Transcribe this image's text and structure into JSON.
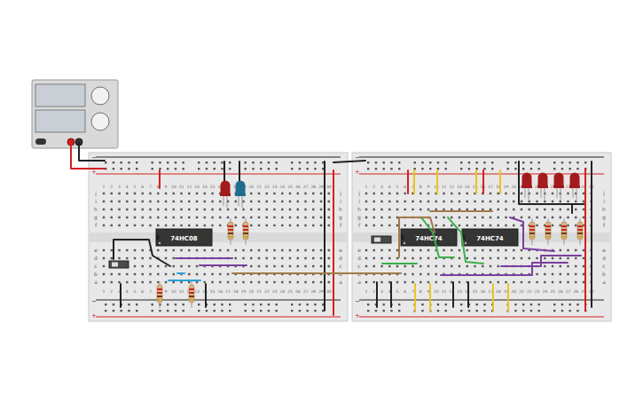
{
  "chips": [
    {
      "label": "74HC08"
    },
    {
      "label": "74HC74"
    },
    {
      "label": "74HC74"
    }
  ],
  "breadboards": [
    {
      "columns": [
        "1",
        "2",
        "3",
        "4",
        "5",
        "6",
        "7",
        "8",
        "9",
        "10",
        "11",
        "12",
        "13",
        "14",
        "15",
        "16",
        "17",
        "18",
        "19",
        "20",
        "21",
        "22",
        "23",
        "24",
        "25",
        "26",
        "27",
        "28",
        "29",
        "30"
      ],
      "rows_top": [
        "j",
        "i",
        "h",
        "g",
        "f"
      ],
      "rows_bottom": [
        "e",
        "d",
        "c",
        "b",
        "a"
      ]
    },
    {
      "columns": [
        "1",
        "2",
        "3",
        "4",
        "5",
        "6",
        "7",
        "8",
        "9",
        "10",
        "11",
        "12",
        "13",
        "14",
        "15",
        "16",
        "17",
        "18",
        "19",
        "20",
        "21",
        "22",
        "23",
        "24",
        "25",
        "26",
        "27",
        "28",
        "29",
        "30"
      ],
      "rows_top": [
        "j",
        "i",
        "h",
        "g",
        "f"
      ],
      "rows_bottom": [
        "e",
        "d",
        "c",
        "b",
        "a"
      ]
    }
  ],
  "rail_signs": {
    "minus": "−",
    "plus": "+"
  },
  "switches": [
    {
      "on": false
    },
    {
      "on": false
    }
  ],
  "leds": [
    {
      "color": "#a3191c"
    },
    {
      "color": "#1f6f8b"
    },
    {
      "color": "#a3191c"
    },
    {
      "color": "#a3191c"
    },
    {
      "color": "#a3191c"
    },
    {
      "color": "#a3191c"
    }
  ],
  "wires": [
    {
      "color": "#d42020"
    },
    {
      "color": "#222222"
    },
    {
      "color": "#d42020"
    },
    {
      "color": "#222222"
    },
    {
      "color": "#222222"
    },
    {
      "color": "#222222"
    },
    {
      "color": "#d42020"
    },
    {
      "color": "#222222"
    },
    {
      "color": "#222222"
    },
    {
      "color": "#7b3fa0"
    },
    {
      "color": "#7b3fa0"
    },
    {
      "color": "#2a9fd6"
    },
    {
      "color": "#2a9fd6"
    },
    {
      "color": "#a07a4a"
    },
    {
      "color": "#222222"
    },
    {
      "color": "#222222"
    },
    {
      "color": "#d42020"
    },
    {
      "color": "#e8c520"
    },
    {
      "color": "#e8c520"
    },
    {
      "color": "#e8c520"
    },
    {
      "color": "#d42020"
    },
    {
      "color": "#e8c520"
    },
    {
      "color": "#222222"
    },
    {
      "color": "#3cb04a"
    },
    {
      "color": "#3cb04a"
    },
    {
      "color": "#3cb04a"
    },
    {
      "color": "#a07a4a"
    },
    {
      "color": "#a07a4a"
    },
    {
      "color": "#e8c520"
    },
    {
      "color": "#e8c520"
    },
    {
      "color": "#e8c520"
    },
    {
      "color": "#e8c520"
    },
    {
      "color": "#222222"
    },
    {
      "color": "#222222"
    },
    {
      "color": "#222222"
    },
    {
      "color": "#222222"
    },
    {
      "color": "#7b3fa0"
    },
    {
      "color": "#7b3fa0"
    },
    {
      "color": "#7b3fa0"
    },
    {
      "color": "#d42020"
    },
    {
      "color": "#222222"
    },
    {
      "color": "#222222"
    }
  ]
}
